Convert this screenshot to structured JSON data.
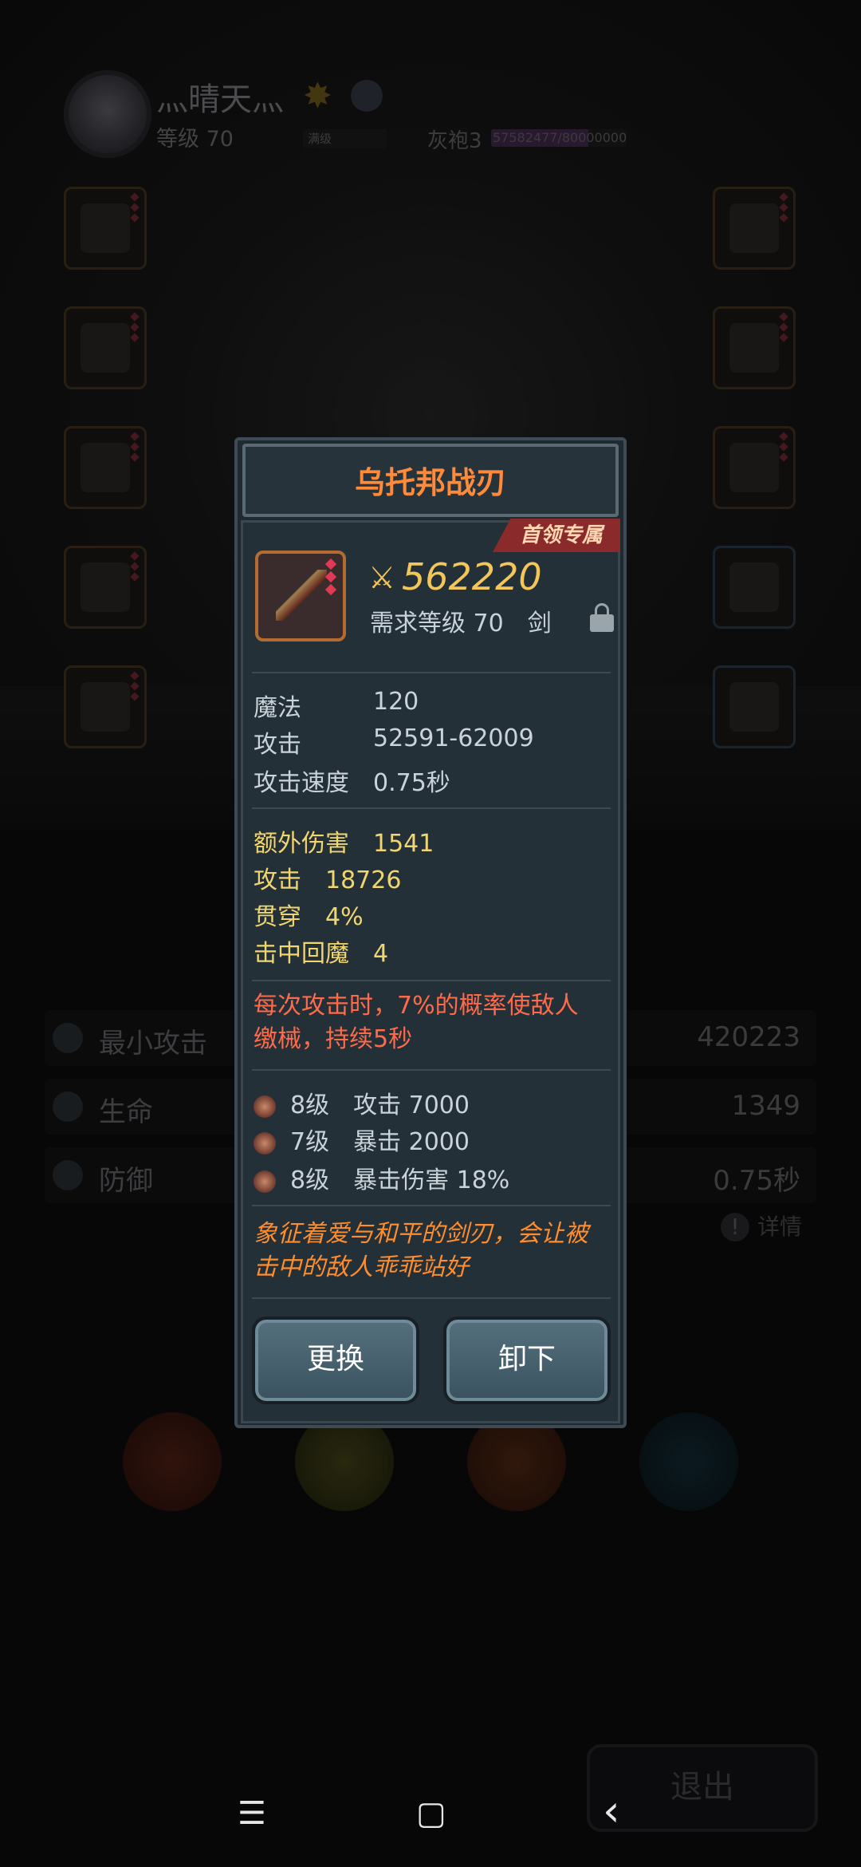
{
  "header": {
    "player_name": "灬晴天灬",
    "level_text": "等级 70",
    "max_level_text": "满级",
    "rank": "灰袍3",
    "exp_text": "57582477/80000000",
    "exp_progress": 0.72
  },
  "stats": [
    {
      "label": "最小攻击",
      "value": "420223"
    },
    {
      "label": "生命",
      "value": "1349"
    },
    {
      "label": "防御",
      "value": "0.75秒"
    }
  ],
  "detail_label": "详情",
  "exit_label": "退出",
  "popup": {
    "title": "乌托邦战刃",
    "ribbon": "首领专属",
    "price": "562220",
    "requirement": "需求等级 70　剑",
    "base_stats": [
      {
        "label": "魔法",
        "value": "120"
      },
      {
        "label": "攻击",
        "value": "52591-62009"
      },
      {
        "label": "攻击速度",
        "value": "0.75秒"
      }
    ],
    "bonus_stats": [
      {
        "label": "额外伤害",
        "value": "1541"
      },
      {
        "label": "攻击",
        "value": "18726"
      },
      {
        "label": "贯穿",
        "value": "4%"
      },
      {
        "label": "击中回魔",
        "value": "4"
      }
    ],
    "effect_line1": "每次攻击时，7%的概率使敌人",
    "effect_line2": "缴械，持续5秒",
    "gems": [
      {
        "level": "8级",
        "effect": "攻击 7000"
      },
      {
        "level": "7级",
        "effect": "暴击 2000"
      },
      {
        "level": "8级",
        "effect": "暴击伤害 18%"
      }
    ],
    "flavor_line1": "象征着爱与和平的剑刃，会让被",
    "flavor_line2": "击中的敌人乖乖站好",
    "buttons": {
      "replace": "更换",
      "unequip": "卸下"
    }
  },
  "nav": {
    "menu": "☰",
    "home": "▢",
    "back": "‹"
  },
  "colors": {
    "title": "#ff8a3a",
    "price": "#f3c65a",
    "bonus": "#f1d670",
    "effect": "#ff6a4a",
    "flavor": "#ff8d2e"
  }
}
